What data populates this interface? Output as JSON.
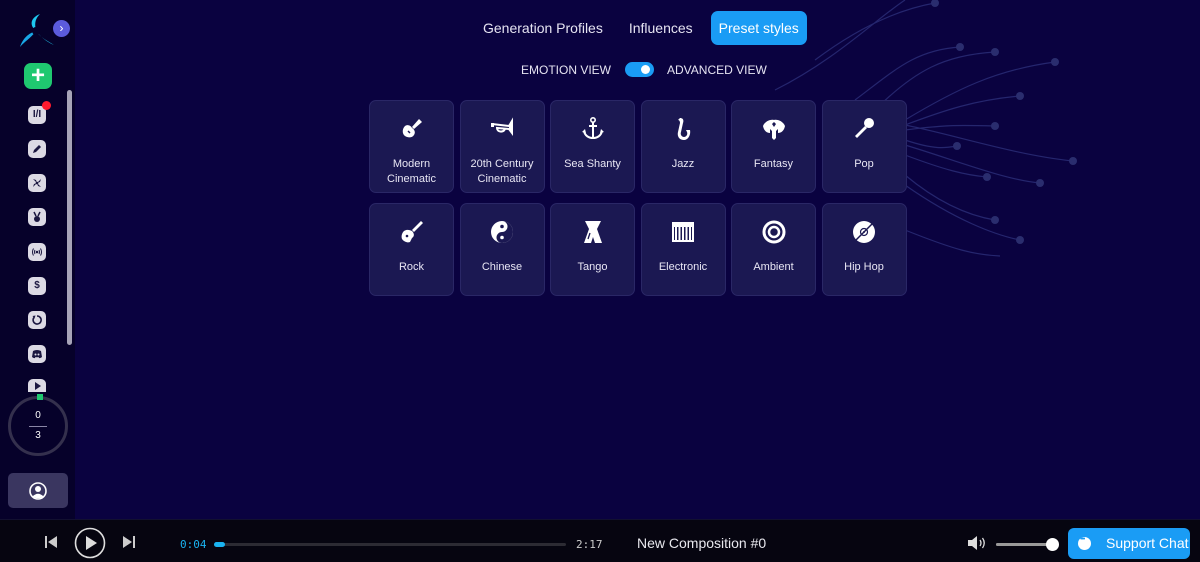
{
  "sidebar": {
    "expand_icon": "chevron-right-icon",
    "add_label": "+",
    "items": [
      {
        "name": "lyrics-icon",
        "glyph": "I/I",
        "badge": true
      },
      {
        "name": "pencil-icon"
      },
      {
        "name": "fan-icon"
      },
      {
        "name": "medal-icon"
      },
      {
        "name": "broadcast-icon"
      },
      {
        "name": "dollar-icon"
      },
      {
        "name": "history-icon"
      },
      {
        "name": "discord-icon"
      },
      {
        "name": "play-icon"
      }
    ],
    "credits": {
      "used": "0",
      "total": "3"
    }
  },
  "tabs": [
    {
      "label": "Generation Profiles",
      "active": false
    },
    {
      "label": "Influences",
      "active": false
    },
    {
      "label": "Preset styles",
      "active": true
    }
  ],
  "view_toggle": {
    "left_label": "EMOTION VIEW",
    "right_label": "ADVANCED VIEW",
    "on": true
  },
  "presets": [
    {
      "icon": "violin-icon",
      "label": "Modern Cinematic"
    },
    {
      "icon": "bugle-icon",
      "label": "20th Century Cinematic"
    },
    {
      "icon": "anchor-icon",
      "label": "Sea Shanty"
    },
    {
      "icon": "saxophone-icon",
      "label": "Jazz"
    },
    {
      "icon": "dragon-icon",
      "label": "Fantasy"
    },
    {
      "icon": "microphone-icon",
      "label": "Pop"
    },
    {
      "icon": "guitar-icon",
      "label": "Rock"
    },
    {
      "icon": "yin-yang-icon",
      "label": "Chinese"
    },
    {
      "icon": "tango-dancers-icon",
      "label": "Tango"
    },
    {
      "icon": "keyboard-icon",
      "label": "Electronic"
    },
    {
      "icon": "ambient-circle-icon",
      "label": "Ambient"
    },
    {
      "icon": "vinyl-record-icon",
      "label": "Hip Hop"
    }
  ],
  "player": {
    "current_time": "0:04",
    "total_time": "2:17",
    "progress": 0.03,
    "title": "New Composition #0",
    "volume": 1.0,
    "support_label": "Support Chat"
  },
  "colors": {
    "background": "#0a0240",
    "accent": "#1a9cf5",
    "add_button": "#1fc870",
    "card": "#1b1852"
  }
}
